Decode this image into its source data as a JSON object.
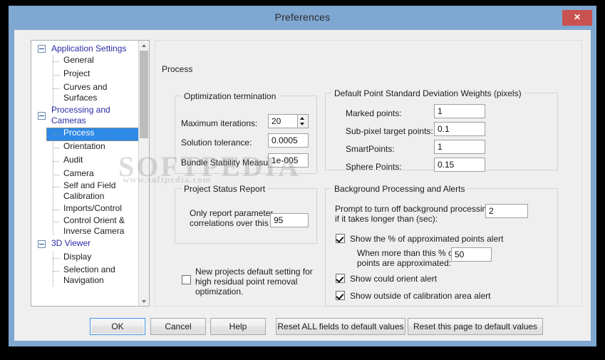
{
  "window": {
    "title": "Preferences",
    "close_label": "✕",
    "accent_color": "#7ea7d1",
    "close_color": "#c9514f"
  },
  "watermark": {
    "main": "SOFTPEDIA",
    "sub": "www.softpedia.com"
  },
  "sidebar": {
    "scrollbar": {
      "up": "▲",
      "down": "▼"
    },
    "items": [
      {
        "label": "Application Settings",
        "level": 0,
        "expander": "minus",
        "selected": false
      },
      {
        "label": "General",
        "level": 1,
        "selected": false
      },
      {
        "label": "Project",
        "level": 1,
        "selected": false
      },
      {
        "label": "Curves and Surfaces",
        "level": 1,
        "selected": false
      },
      {
        "label": "Processing and Cameras",
        "level": 0,
        "expander": "minus",
        "selected": false
      },
      {
        "label": "Process",
        "level": 1,
        "selected": true
      },
      {
        "label": "Orientation",
        "level": 1,
        "selected": false
      },
      {
        "label": "Audit",
        "level": 1,
        "selected": false
      },
      {
        "label": "Camera",
        "level": 1,
        "selected": false
      },
      {
        "label": "Self and Field Calibration",
        "level": 1,
        "selected": false
      },
      {
        "label": "Imports/Control",
        "level": 1,
        "selected": false
      },
      {
        "label": "Control Orient & Inverse Camera",
        "level": 1,
        "selected": false
      },
      {
        "label": "3D Viewer",
        "level": 0,
        "expander": "minus",
        "selected": false
      },
      {
        "label": "Display",
        "level": 1,
        "selected": false
      },
      {
        "label": "Selection and Navigation",
        "level": 1,
        "selected": false
      }
    ]
  },
  "page": {
    "title": "Process",
    "optimization": {
      "title": "Optimization termination",
      "max_iterations_label": "Maximum iterations:",
      "max_iterations_value": "20",
      "solution_tolerance_label": "Solution tolerance:",
      "solution_tolerance_value": "0.0005",
      "bundle_stability_label": "Bundle Stability Measure:",
      "bundle_stability_value": "1e-005"
    },
    "status_report": {
      "title": "Project Status Report",
      "correlations_label_line1": "Only report parameter",
      "correlations_label_line2": "correlations over this %:",
      "correlations_value": "95"
    },
    "residual_removal": {
      "label_line1": "New projects default setting for",
      "label_line2": "high residual point removal",
      "label_line3": "optimization.",
      "checked": false
    },
    "weights": {
      "title": "Default Point Standard Deviation Weights (pixels)",
      "rows": [
        {
          "label": "Marked points:",
          "value": "1"
        },
        {
          "label": "Sub-pixel target points:",
          "value": "0.1"
        },
        {
          "label": "SmartPoints:",
          "value": "1"
        },
        {
          "label": "Sphere Points:",
          "value": "0.15"
        }
      ]
    },
    "alerts": {
      "title": "Background Processing and Alerts",
      "prompt_label_line1": "Prompt to turn off background processing",
      "prompt_label_line2": "if it takes longer than (sec):",
      "prompt_value": "2",
      "approx_alert_label": "Show the % of approximated points alert",
      "approx_alert_checked": true,
      "approx_threshold_label_line1": "When more than this % of",
      "approx_threshold_label_line2": "points are approximated:",
      "approx_threshold_value": "50",
      "could_orient_label": "Show could orient alert",
      "could_orient_checked": true,
      "outside_calibration_label": "Show outside of calibration area alert",
      "outside_calibration_checked": true
    }
  },
  "buttons": {
    "ok": "OK",
    "cancel": "Cancel",
    "help": "Help",
    "reset_all": "Reset ALL fields to default values",
    "reset_page": "Reset this page to default values"
  }
}
